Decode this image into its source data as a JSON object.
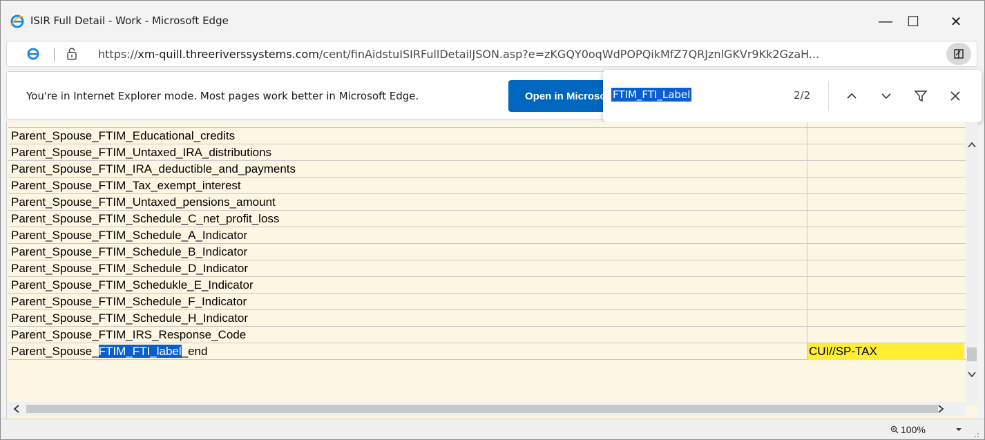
{
  "window": {
    "title": "ISIR Full Detail - Work - Microsoft Edge",
    "minimize_glyph": "—",
    "maximize_glyph": "☐",
    "close_glyph": "✕"
  },
  "address": {
    "url_prefix": "https://",
    "url_domain": "xm-quill.threeriverssystems.com",
    "url_path": "/cent/finAidstuISIRFullDetailJSON.asp?e=zKGQY0oqWdPOPQikMfZ7QRJznlGKVr9Kk2GzaH..."
  },
  "infobar": {
    "message": "You're in Internet Explorer mode. Most pages work better in Microsoft Edge.",
    "button_label": "Open in Microsoft Edge"
  },
  "find": {
    "query": "FTIM_FTI_Label",
    "count": "2/2"
  },
  "rows": [
    {
      "label": "Parent_Spouse_FTIM_Educational_credits",
      "value": ""
    },
    {
      "label": "Parent_Spouse_FTIM_Untaxed_IRA_distributions",
      "value": ""
    },
    {
      "label": "Parent_Spouse_FTIM_IRA_deductible_and_payments",
      "value": ""
    },
    {
      "label": "Parent_Spouse_FTIM_Tax_exempt_interest",
      "value": ""
    },
    {
      "label": "Parent_Spouse_FTIM_Untaxed_pensions_amount",
      "value": ""
    },
    {
      "label": "Parent_Spouse_FTIM_Schedule_C_net_profit_loss",
      "value": ""
    },
    {
      "label": "Parent_Spouse_FTIM_Schedule_A_Indicator",
      "value": ""
    },
    {
      "label": "Parent_Spouse_FTIM_Schedule_B_Indicator",
      "value": ""
    },
    {
      "label": "Parent_Spouse_FTIM_Schedule_D_Indicator",
      "value": ""
    },
    {
      "label": "Parent_Spouse_FTIM_Schedukle_E_Indicator",
      "value": ""
    },
    {
      "label": "Parent_Spouse_FTIM_Schedule_F_Indicator",
      "value": ""
    },
    {
      "label": "Parent_Spouse_FTIM_Schedule_H_Indicator",
      "value": ""
    },
    {
      "label": "Parent_Spouse_FTIM_IRS_Response_Code",
      "value": ""
    }
  ],
  "last_row": {
    "label_before": "Parent_Spouse_",
    "label_match": "FTIM_FTI_label",
    "label_after": "_end",
    "value": "CUI//SP-TAX"
  },
  "status": {
    "zoom": "100%"
  },
  "colors": {
    "content_bg": "#fdf6e3",
    "highlight": "#0a5fd0",
    "value_highlight": "#ffee33",
    "button_blue": "#0067c0"
  }
}
